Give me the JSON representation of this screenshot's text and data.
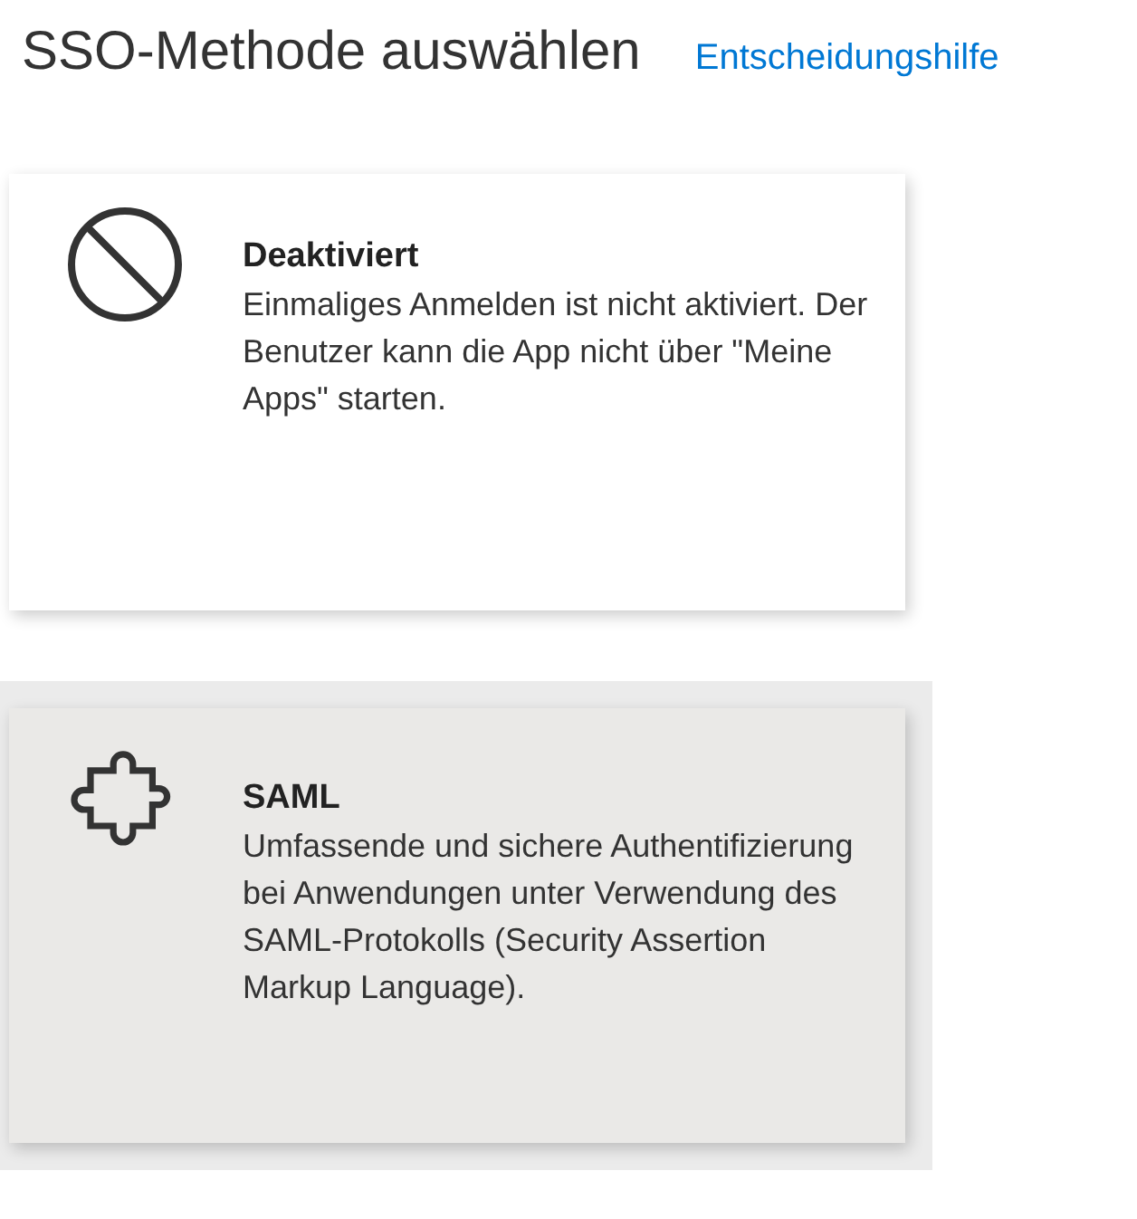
{
  "header": {
    "title": "SSO-Methode auswählen",
    "help_link": "Entscheidungshilfe"
  },
  "methods": [
    {
      "kind": "disabled",
      "title": "Deaktiviert",
      "description": "Einmaliges Anmelden ist nicht aktiviert. Der Benutzer kann die App nicht über \"Meine Apps\" starten.",
      "selected": false
    },
    {
      "kind": "saml",
      "title": "SAML",
      "description": "Umfassende und sichere Authentifizierung bei Anwendungen unter Verwendung des SAML-Protokolls (Security Assertion Markup Language).",
      "selected": true
    }
  ]
}
